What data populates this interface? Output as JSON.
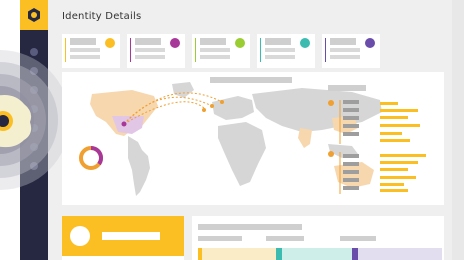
{
  "header": {
    "title": "Identity Details"
  },
  "cards": [
    {
      "accent": "#fbbf24",
      "dot": "#fbbf24"
    },
    {
      "accent": "#a8379a",
      "dot": "#a8379a"
    },
    {
      "accent": "#9acd32",
      "dot": "#9acd32"
    },
    {
      "accent": "#3cbcb0",
      "dot": "#3cbcb0"
    },
    {
      "accent": "#6a4cab",
      "dot": "#6a4cab"
    }
  ],
  "colors": {
    "sidebar": "#262842",
    "accent": "#fbbf24",
    "map_land": "#d6d6d6",
    "map_highlight_orange": "#f7d7ae",
    "map_highlight_purple": "#e2c6e6"
  },
  "icons": {
    "logo": "hex-logo-icon"
  }
}
